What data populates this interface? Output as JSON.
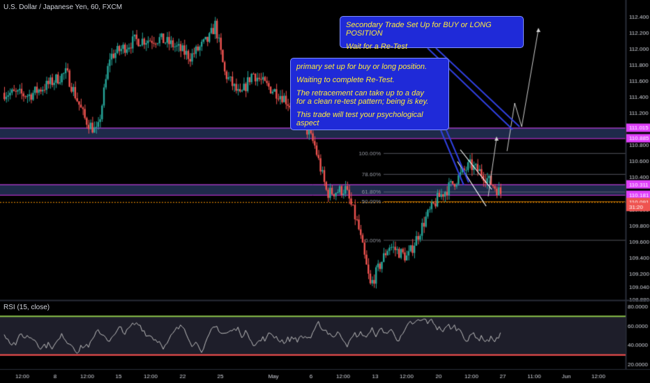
{
  "header": {
    "symbol_label": "U.S. Dollar / Japanese Yen, 60, FXCM"
  },
  "rsi": {
    "label": "RSI (15, close)",
    "upper": 70,
    "lower": 30
  },
  "callouts": {
    "secondary": {
      "lines": [
        "Secondary Trade Set Up for BUY or LONG POSITION",
        "Wait for a Re-Test"
      ]
    },
    "primary": {
      "lines": [
        "primary set up for buy or long position.",
        "Waiting to complete Re-Test.",
        "The retracement can take up to a day\nfor a clean re-test pattern; being is key.",
        "This trade will test your psychological aspect"
      ]
    }
  },
  "colors": {
    "background": "#000000",
    "zone_fill": "#1e2a4a",
    "zone_line": "#e040fb",
    "callout_fill": "#1f2ad8",
    "callout_text": "#ffeb3b",
    "up_candle": "#26a69a",
    "down_candle": "#ef5350",
    "rsi_line": "#c0c0c0",
    "rsi_upper": "#8bc34a",
    "rsi_lower": "#ff5252",
    "fib_line": "#787b86",
    "fib_orange": "#ff9800"
  },
  "chart_data": {
    "type": "candlestick",
    "title": "U.S. Dollar / Japanese Yen, 60, FXCM",
    "ylim": [
      108.88,
      112.5
    ],
    "yticks": [
      "112.400",
      "112.200",
      "112.000",
      "111.800",
      "111.600",
      "111.400",
      "111.200",
      "111.000",
      "110.800",
      "110.600",
      "110.400",
      "110.200",
      "110.000",
      "109.800",
      "109.600",
      "109.400",
      "109.200",
      "109.040",
      "108.880"
    ],
    "xticks": [
      "12:00",
      "8",
      "12:00",
      "15",
      "12:00",
      "22",
      "25",
      "May",
      "6",
      "12:00",
      "13",
      "12:00",
      "20",
      "12:00",
      "27",
      "11:00",
      "Jun",
      "12:00"
    ],
    "price_path": [
      [
        0,
        111.45
      ],
      [
        0.04,
        111.42
      ],
      [
        0.07,
        111.55
      ],
      [
        0.1,
        111.7
      ],
      [
        0.13,
        111.12
      ],
      [
        0.15,
        110.95
      ],
      [
        0.17,
        111.9
      ],
      [
        0.21,
        112.1
      ],
      [
        0.25,
        112.12
      ],
      [
        0.27,
        112.05
      ],
      [
        0.3,
        111.9
      ],
      [
        0.33,
        112.12
      ],
      [
        0.34,
        112.3
      ],
      [
        0.355,
        111.7
      ],
      [
        0.38,
        111.4
      ],
      [
        0.4,
        111.7
      ],
      [
        0.42,
        111.55
      ],
      [
        0.45,
        111.4
      ],
      [
        0.48,
        111.1
      ],
      [
        0.5,
        110.8
      ],
      [
        0.52,
        110.2
      ],
      [
        0.55,
        110.25
      ],
      [
        0.57,
        109.8
      ],
      [
        0.59,
        109.05
      ],
      [
        0.62,
        109.55
      ],
      [
        0.65,
        109.4
      ],
      [
        0.68,
        109.9
      ],
      [
        0.7,
        110.15
      ],
      [
        0.72,
        110.3
      ],
      [
        0.75,
        110.55
      ],
      [
        0.77,
        110.45
      ],
      [
        0.8,
        110.2
      ]
    ],
    "zones": [
      {
        "top": 111.015,
        "bottom": 110.885,
        "labels": [
          "111.015",
          "110.885"
        ]
      },
      {
        "top": 110.311,
        "bottom": 110.181,
        "labels": [
          "110.311",
          "110.181"
        ]
      }
    ],
    "levels": [
      {
        "value": 110.091,
        "label": "110.091"
      }
    ],
    "price_tags": [
      "112.400",
      "31:20"
    ],
    "fib": [
      {
        "level": "100.00%",
        "value": 110.7
      },
      {
        "level": "78.60%",
        "value": 110.44
      },
      {
        "level": "61.80%",
        "value": 110.22
      },
      {
        "level": "50.00%",
        "value": 110.1
      },
      {
        "level": "0.00%",
        "value": 109.62
      }
    ],
    "rsi": {
      "ylim": [
        15,
        85
      ],
      "yticks": [
        "80.0000",
        "60.0000",
        "40.0000",
        "20.0000"
      ],
      "upper": 70,
      "lower": 30
    }
  }
}
